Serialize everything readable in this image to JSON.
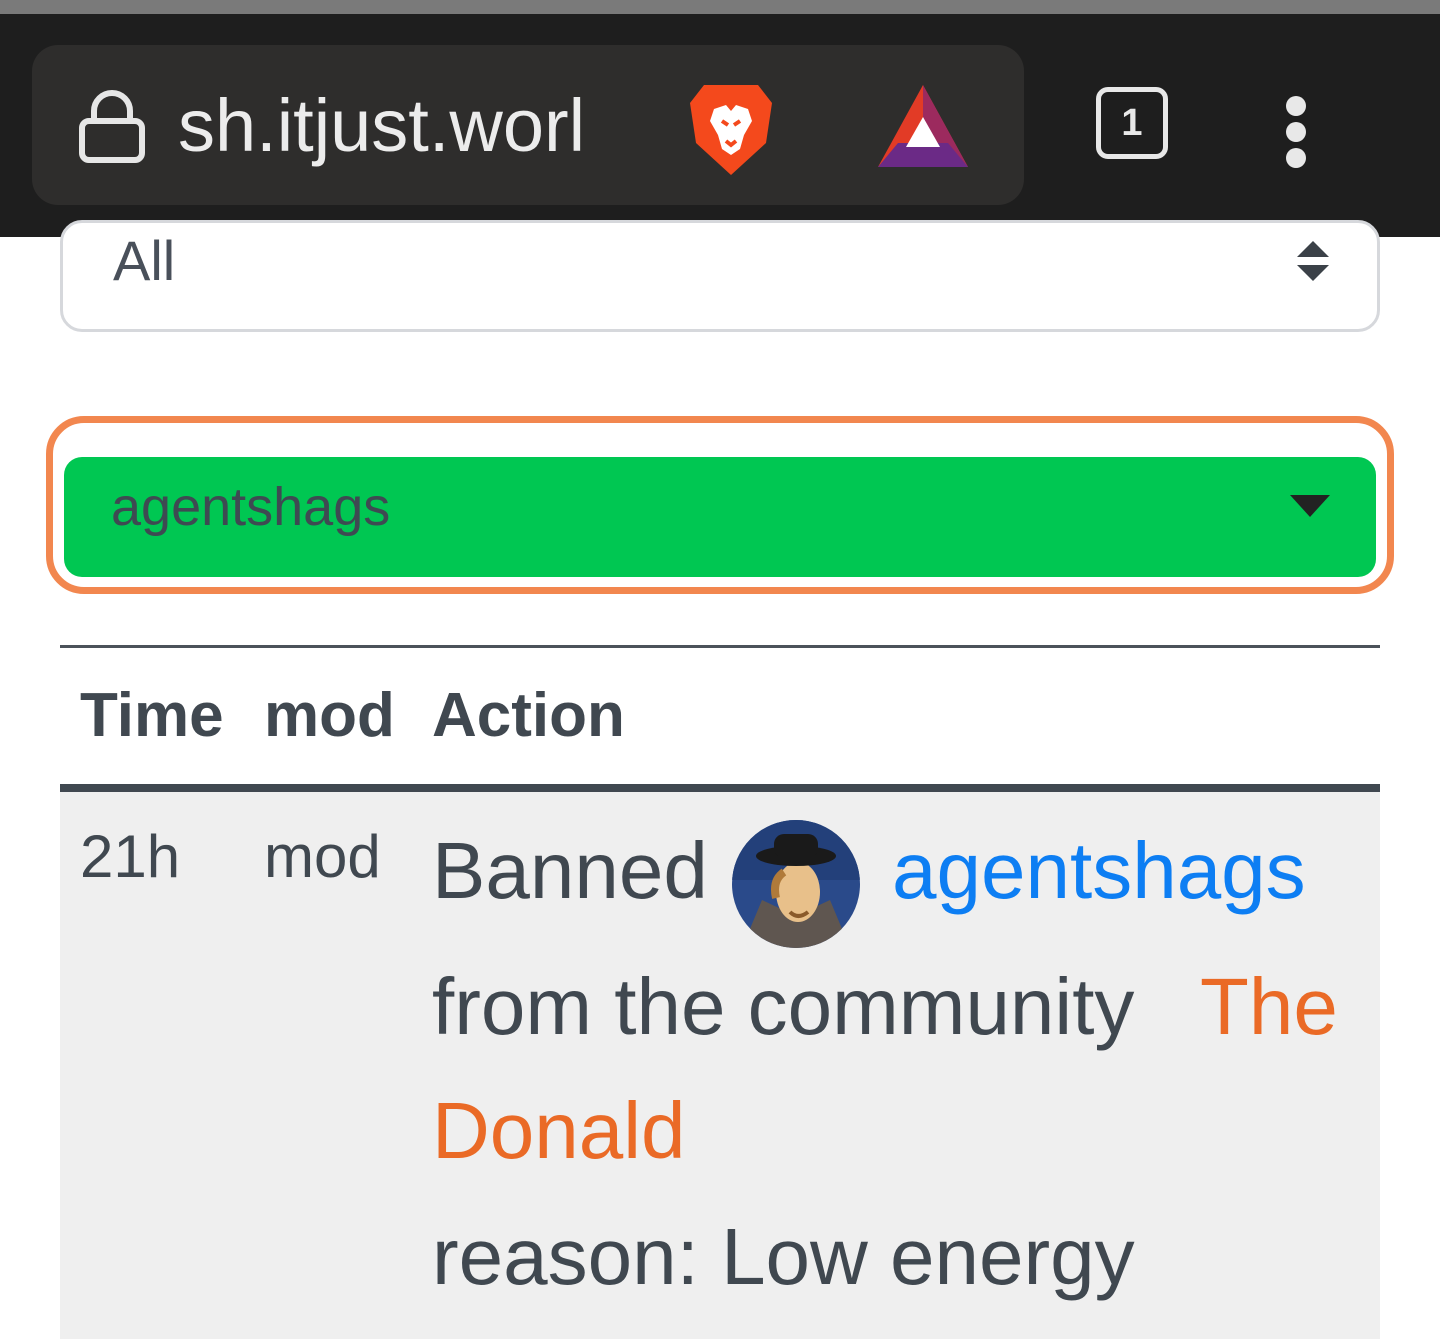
{
  "browser": {
    "url": "sh.itjust.worl",
    "tab_count": "1",
    "icons": [
      "lock-icon",
      "brave-lion-icon",
      "bat-rewards-icon",
      "tab-switcher-icon",
      "overflow-menu-icon"
    ]
  },
  "filters": {
    "type_select_value": "All",
    "user_select_value": "agentshags"
  },
  "table": {
    "headers": [
      "Time",
      "mod",
      "Action"
    ],
    "rows": [
      {
        "time": "21h",
        "mod": "mod",
        "action": {
          "verb": "Banned",
          "user": "agentshags",
          "from_text": "from the community",
          "community_word1": "The",
          "community_word2": "Donald",
          "reason": "reason: Low energy"
        }
      }
    ]
  },
  "colors": {
    "browser_bar": "#1e1e1e",
    "selected_user_bg": "#00c752",
    "focus_ring": "#f2874f",
    "user_link": "#0d7ef3",
    "community_link": "#ea6a26",
    "row_bg": "#efefef"
  }
}
